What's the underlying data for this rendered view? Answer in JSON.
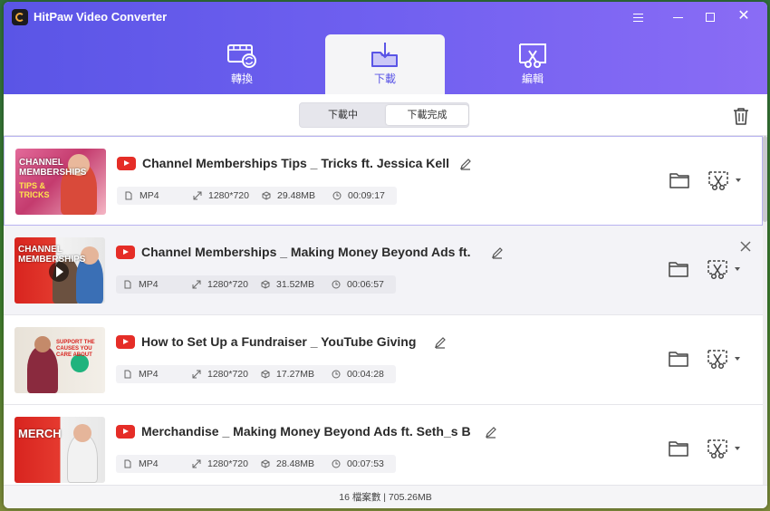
{
  "app": {
    "title": "HitPaw Video Converter"
  },
  "tabs": [
    {
      "label": "轉換",
      "icon": "film-convert-icon"
    },
    {
      "label": "下載",
      "icon": "download-folder-icon",
      "active": true
    },
    {
      "label": "編輯",
      "icon": "scissors-edit-icon"
    }
  ],
  "segment": {
    "downloading": "下載中",
    "finished": "下載完成",
    "selected": "finished"
  },
  "items": [
    {
      "title": "Channel Memberships Tips _ Tricks ft. Jessica Kell",
      "format": "MP4",
      "resolution": "1280*720",
      "size": "29.48MB",
      "duration": "00:09:17",
      "thumb_caption": "CHANNEL MEMBERSHIPS",
      "thumb_caption2": "TIPS & TRICKS"
    },
    {
      "title": "Channel Memberships _ Making Money Beyond Ads ft.",
      "format": "MP4",
      "resolution": "1280*720",
      "size": "31.52MB",
      "duration": "00:06:57",
      "thumb_caption": "CHANNEL MEMBERSHIPS",
      "thumb_caption2": ""
    },
    {
      "title": "How to Set Up a Fundraiser _ YouTube Giving",
      "format": "MP4",
      "resolution": "1280*720",
      "size": "17.27MB",
      "duration": "00:04:28",
      "thumb_caption": "SUPPORT THE CAUSES YOU CARE ABOUT",
      "thumb_caption2": ""
    },
    {
      "title": "Merchandise _ Making Money Beyond Ads ft. Seth_s B",
      "format": "MP4",
      "resolution": "1280*720",
      "size": "28.48MB",
      "duration": "00:07:53",
      "thumb_caption": "MERCH",
      "thumb_caption2": ""
    }
  ],
  "footer": {
    "summary": "16 檔案數 | 705.26MB"
  },
  "colors": {
    "accent": "#5a55e6",
    "youtube_red": "#e52d27"
  }
}
